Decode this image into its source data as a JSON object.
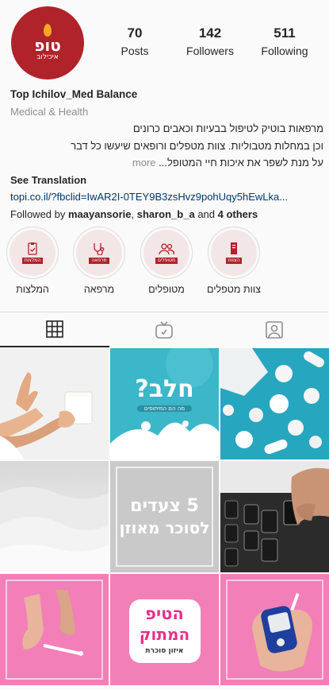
{
  "profile": {
    "avatar_logo_main": "טופ",
    "avatar_logo_sub": "איכילוב",
    "stats": [
      {
        "value": "70",
        "label": "Posts"
      },
      {
        "value": "142",
        "label": "Followers"
      },
      {
        "value": "511",
        "label": "Following"
      }
    ],
    "name": "Top Ichilov_Med Balance",
    "category": "Medical & Health",
    "bio_line1": "מרפאות בוטיק לטיפול בבעיות וכאבים כרונים",
    "bio_line2": "וכן במחלות מטבוליות. צוות מטפלים ורופאים שיעשו כל דבר",
    "bio_line3": "על מנת לשפר את איכות חיי המטופל...",
    "more_label": "more",
    "see_translation": "See Translation",
    "link": "topi.co.il/?fbclid=IwAR2I-0TEY9B3zsHvz9pohUqy5hEwLka...",
    "followed_by_prefix": "Followed by ",
    "followed_user1": "maayansorie",
    "followed_sep": ", ",
    "followed_user2": "sharon_b_a",
    "followed_and": " and ",
    "followed_others": "4 others"
  },
  "highlights": [
    {
      "label": "המלצות",
      "tag": "המלצות",
      "icon": "clipboard-icon"
    },
    {
      "label": "מרפאה",
      "tag": "מרפאה",
      "icon": "stethoscope-icon"
    },
    {
      "label": "מטופלים",
      "tag": "מטופלים",
      "icon": "people-icon"
    },
    {
      "label": "צוות מטפלים",
      "tag": "הצוות",
      "icon": "document-icon"
    }
  ],
  "tabs": [
    {
      "name": "grid",
      "icon": "grid-icon",
      "active": true
    },
    {
      "name": "igtv",
      "icon": "tv-icon",
      "active": false
    },
    {
      "name": "tagged",
      "icon": "person-tag-icon",
      "active": false
    }
  ],
  "posts": {
    "post2_title": "חלב?",
    "post2_sub": "מה הם המיתוסים",
    "post5_line1": "5 צעדים",
    "post5_line2": "לסוכר מאוזן",
    "post8_line1": "הטיפ",
    "post8_line2": "המתוק",
    "post8_line3": "איזון סוכרת"
  },
  "colors": {
    "brand_red": "#b0232a",
    "link_blue": "#00376b",
    "muted": "#8e8e8e",
    "pink": "#f27fb8",
    "teal": "#3cb6c9"
  }
}
